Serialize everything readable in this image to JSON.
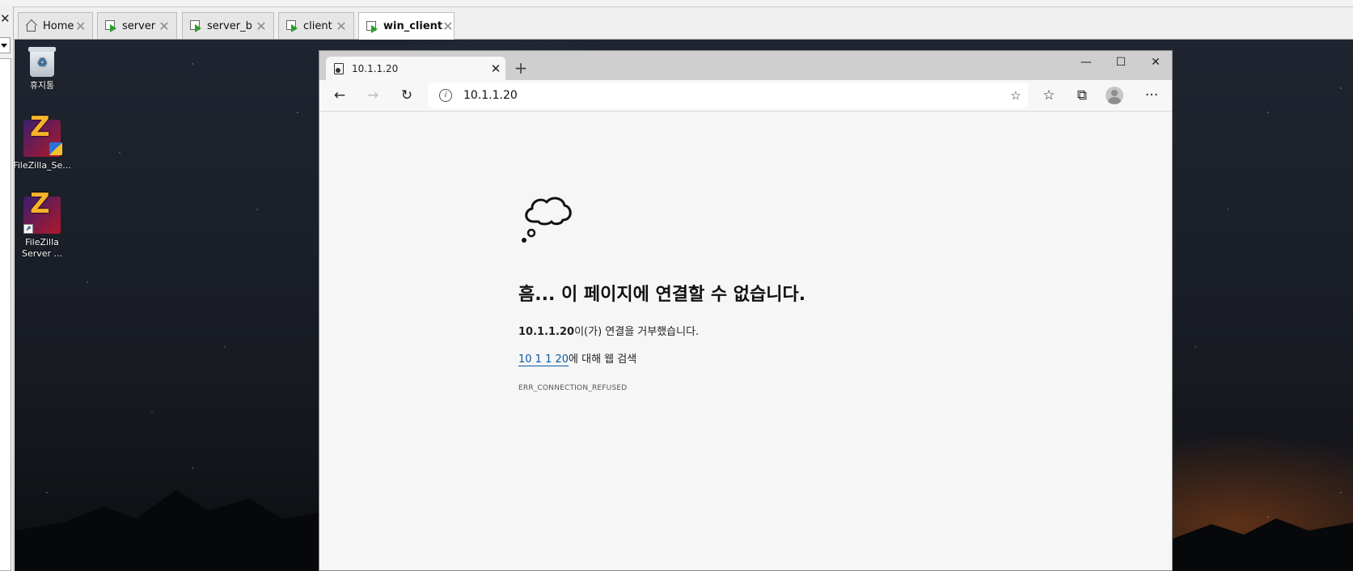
{
  "host": {
    "left_close_glyph": "✕",
    "tabs": [
      {
        "label": "Home",
        "icon": "home-icon",
        "active": false
      },
      {
        "label": "server",
        "icon": "vm-icon",
        "active": false
      },
      {
        "label": "server_b",
        "icon": "vm-icon",
        "active": false
      },
      {
        "label": "client",
        "icon": "vm-icon",
        "active": false
      },
      {
        "label": "win_client",
        "icon": "vm-icon",
        "active": true
      }
    ],
    "tab_close_glyph": "✕"
  },
  "desktop": {
    "icons": [
      {
        "label": "휴지통",
        "icon": "recycle-bin-icon"
      },
      {
        "label": "FileZilla_Se...",
        "icon": "filezilla-server-icon"
      },
      {
        "label": "FileZilla Server ...",
        "icon": "filezilla-shortcut-icon"
      }
    ]
  },
  "browser": {
    "tab_title": "10.1.1.20",
    "tab_close": "✕",
    "new_tab": "+",
    "window": {
      "minimize": "—",
      "maximize": "☐",
      "close": "✕"
    },
    "toolbar": {
      "back": "←",
      "forward": "→",
      "refresh": "↻",
      "info": "i",
      "address": "10.1.1.20",
      "add_favorite": "☆",
      "favorites": "☆",
      "collections": "⧉",
      "more": "···"
    },
    "error": {
      "title": "흠... 이 페이지에 연결할 수 없습니다.",
      "host": "10.1.1.20",
      "message": "이(가) 연결을 거부했습니다.",
      "search_link": "10 1 1 20",
      "search_suffix": "에 대해 웹 검색",
      "code": "ERR_CONNECTION_REFUSED"
    }
  }
}
